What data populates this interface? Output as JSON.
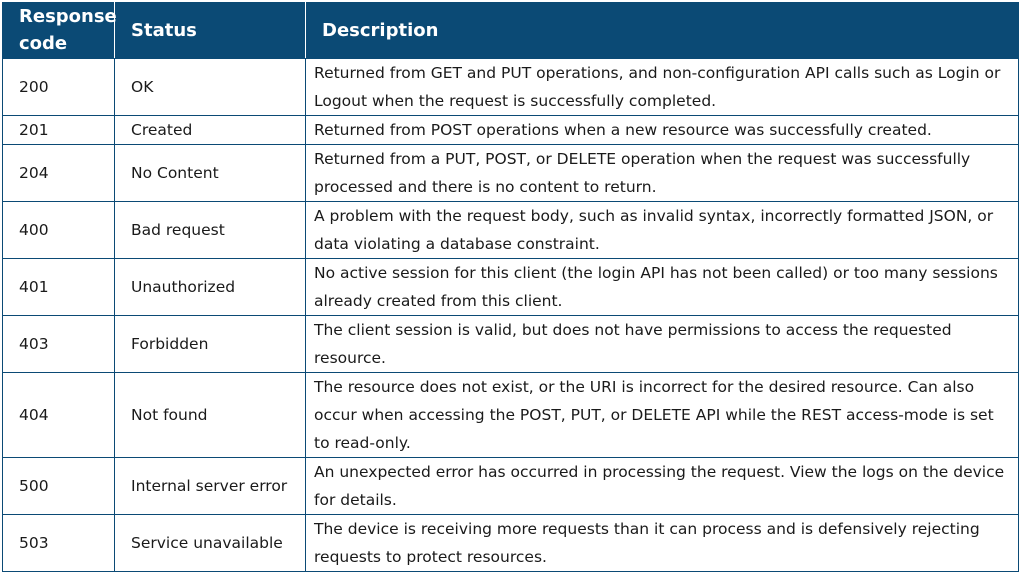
{
  "table": {
    "headers": {
      "code": "Response code",
      "status": "Status",
      "description": "Description"
    },
    "rows": [
      {
        "code": "200",
        "status": "OK",
        "description": "Returned from GET and PUT operations, and non-configuration API calls such as Login or Logout when the request is successfully completed."
      },
      {
        "code": "201",
        "status": "Created",
        "description": "Returned from POST operations when a new resource was successfully created."
      },
      {
        "code": "204",
        "status": "No Content",
        "description": "Returned from a PUT, POST, or DELETE operation when the request was successfully processed and there is no content to return."
      },
      {
        "code": "400",
        "status": "Bad request",
        "description": "A problem with the request body, such as invalid syntax, incorrectly formatted JSON, or data violating a database constraint."
      },
      {
        "code": "401",
        "status": "Unauthorized",
        "description": "No active session for this client (the login API has not been called) or too many sessions already created from this client."
      },
      {
        "code": "403",
        "status": "Forbidden",
        "description": "The client session is valid, but does not have permissions to access the requested resource."
      },
      {
        "code": "404",
        "status": "Not found",
        "description": "The resource does not exist, or the URI is incorrect for the desired resource. Can also occur when accessing the POST, PUT, or DELETE API while the REST access-mode is set to read-only."
      },
      {
        "code": "500",
        "status": "Internal server error",
        "description": "An unexpected error has occurred in processing the request. View the logs on the device for details."
      },
      {
        "code": "503",
        "status": "Service unavailable",
        "description": "The device is receiving more requests than it can process and is defensively rejecting requests to protect resources."
      }
    ],
    "colors": {
      "header_bg": "#0b4a75",
      "header_text": "#ffffff",
      "border": "#0b4a75",
      "body_text": "#1a1a1a"
    }
  }
}
